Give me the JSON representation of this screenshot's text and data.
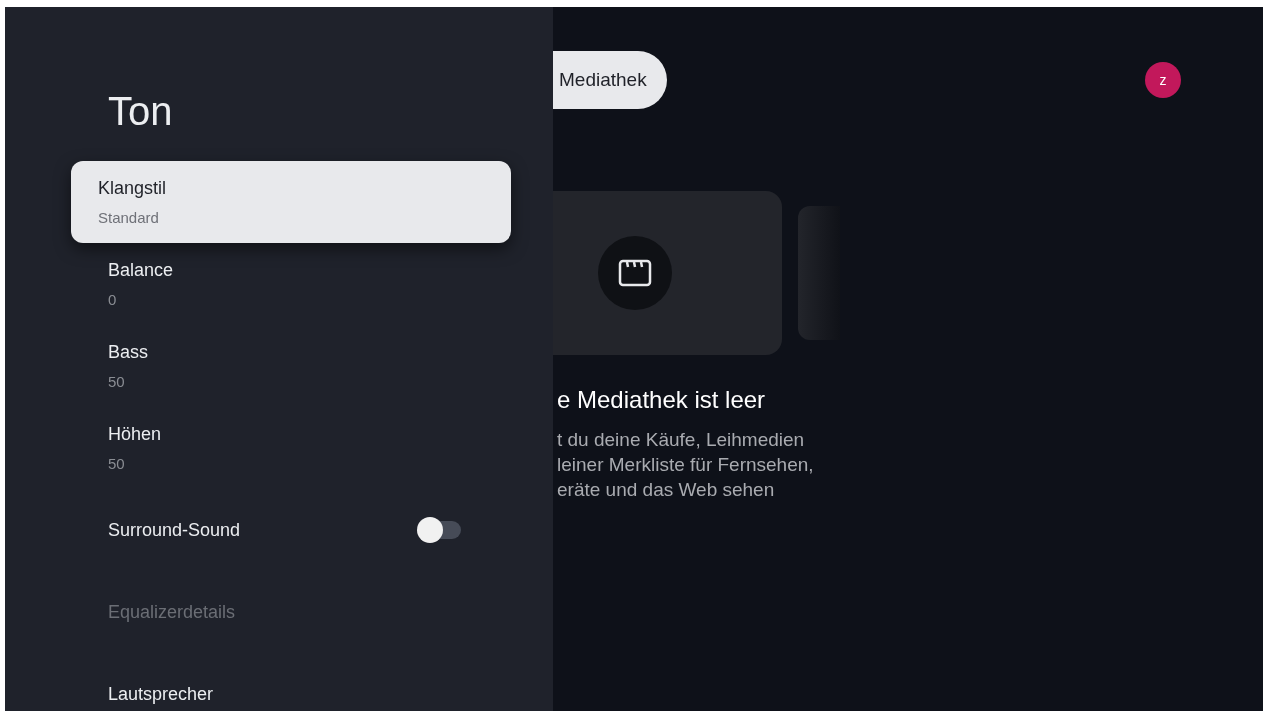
{
  "panel": {
    "title": "Ton",
    "items": [
      {
        "kind": "value",
        "label": "Klangstil",
        "value": "Standard",
        "selected": true,
        "disabled": false
      },
      {
        "kind": "value",
        "label": "Balance",
        "value": "0",
        "selected": false,
        "disabled": false
      },
      {
        "kind": "value",
        "label": "Bass",
        "value": "50",
        "selected": false,
        "disabled": false
      },
      {
        "kind": "value",
        "label": "Höhen",
        "value": "50",
        "selected": false,
        "disabled": false
      },
      {
        "kind": "toggle",
        "label": "Surround-Sound",
        "on": false,
        "selected": false,
        "disabled": false
      },
      {
        "kind": "link",
        "label": "Equalizerdetails",
        "selected": false,
        "disabled": true
      },
      {
        "kind": "link",
        "label": "Lautsprecher",
        "selected": false,
        "disabled": false
      }
    ]
  },
  "background": {
    "tab": "Mediathek",
    "avatar": "z",
    "heading": "e Mediathek ist leer",
    "description_lines": [
      "t du deine Käufe, Leihmedien",
      "leiner Merkliste für Fernsehen,",
      "eräte und das Web sehen"
    ]
  }
}
